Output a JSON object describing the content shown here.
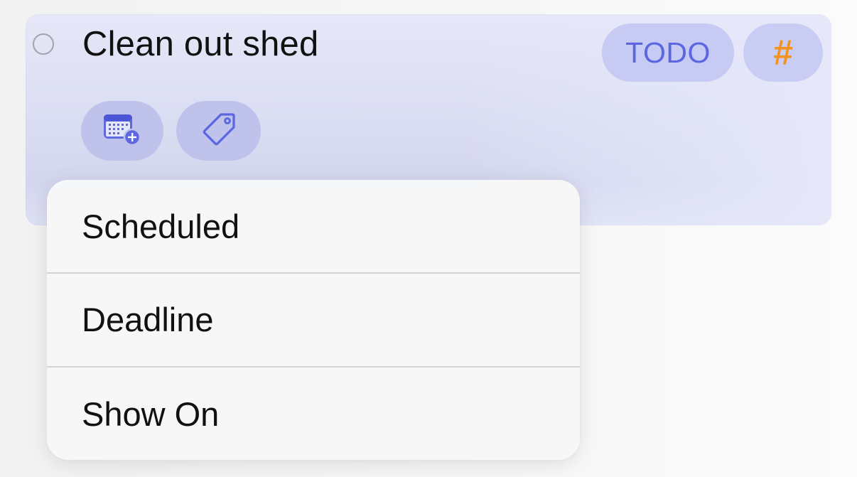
{
  "task": {
    "title": "Clean out shed",
    "status_chip": "TODO",
    "tag_chip": "#",
    "actions": [
      {
        "name": "add-date",
        "icon": "calendar-plus-icon"
      },
      {
        "name": "add-tag",
        "icon": "tag-icon"
      }
    ]
  },
  "date_menu": {
    "items": [
      {
        "label": "Scheduled"
      },
      {
        "label": "Deadline"
      },
      {
        "label": "Show On"
      }
    ]
  },
  "colors": {
    "accent": "#5b66e0",
    "tag": "#f29320",
    "card_background": "#dcdef3",
    "menu_background": "#f7f7f8"
  }
}
